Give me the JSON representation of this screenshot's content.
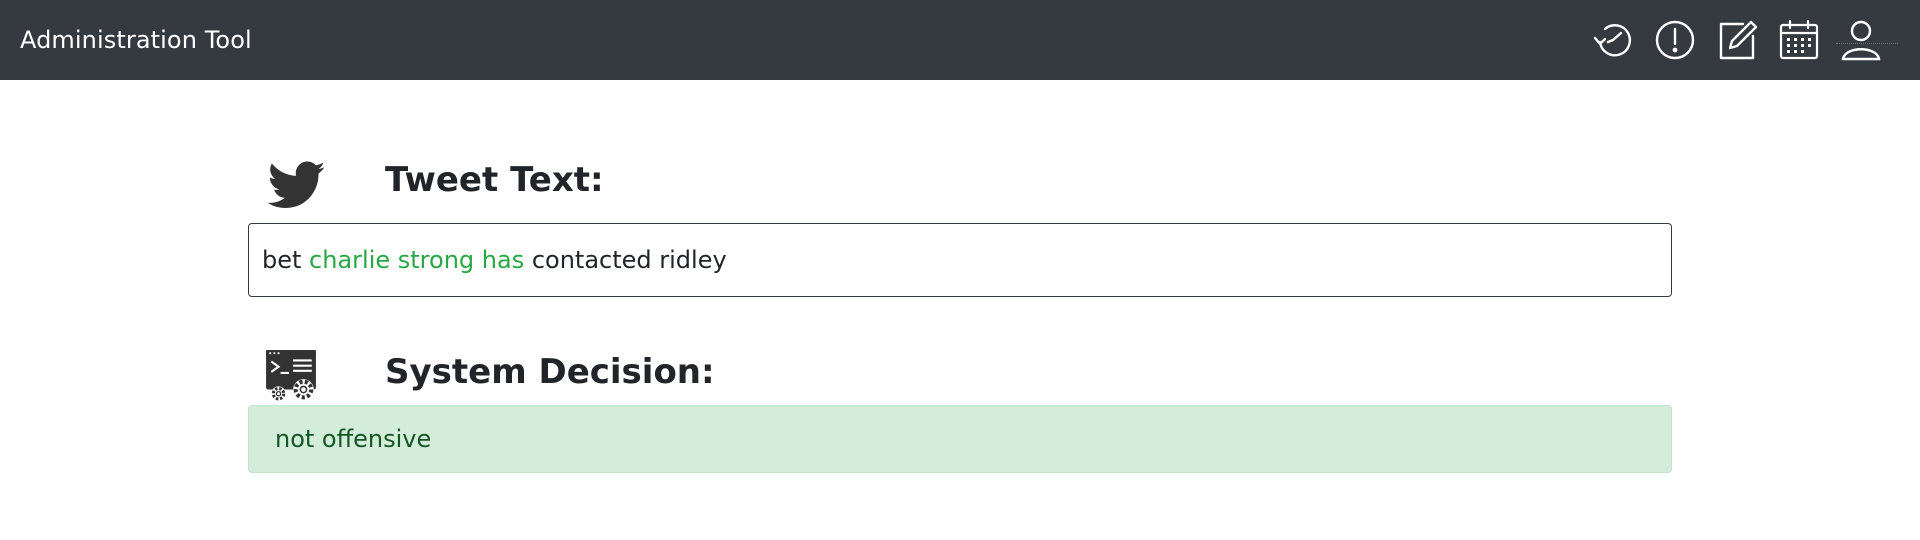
{
  "header": {
    "title": "Administration Tool",
    "icons": [
      "history-icon",
      "alert-icon",
      "edit-icon",
      "calendar-icon",
      "user-icon"
    ]
  },
  "tweet": {
    "heading": "Tweet Text:",
    "segments": [
      {
        "text": "bet ",
        "highlight": false
      },
      {
        "text": "charlie strong has",
        "highlight": true
      },
      {
        "text": " contacted ridley",
        "highlight": false
      }
    ]
  },
  "decision": {
    "heading": "System Decision:",
    "value": "not offensive"
  },
  "colors": {
    "navbar": "#343a40",
    "highlight": "#28a745",
    "decision_bg": "#d4edda",
    "decision_text": "#155724"
  }
}
